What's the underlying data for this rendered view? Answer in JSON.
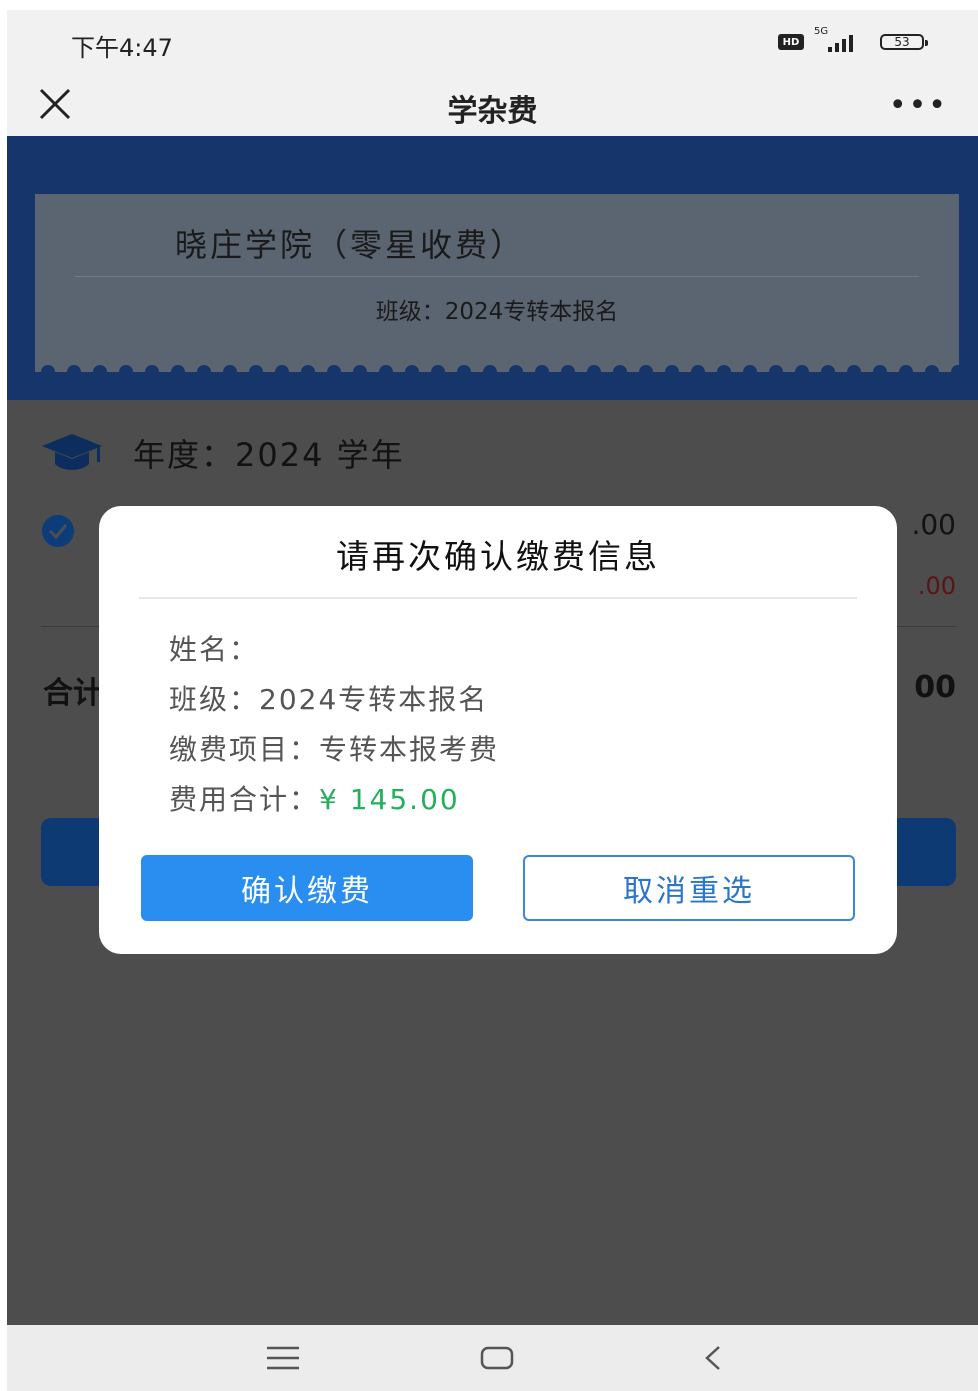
{
  "status_bar": {
    "time": "下午4:47",
    "hd": "HD",
    "network": "5G",
    "battery": "53"
  },
  "nav": {
    "title": "学杂费"
  },
  "header": {
    "school": "晓庄学院（零星收费）",
    "class_line": "班级：2024专转本报名"
  },
  "body": {
    "year_line": "年度：2024 学年",
    "item_amount_peek": ".00",
    "item_sub_amount_peek": ".00",
    "total_label_peek": "合计",
    "total_amount_peek": "00"
  },
  "dialog": {
    "title": "请再次确认缴费信息",
    "name_label": "姓名：",
    "name_value": "",
    "class_label": "班级：",
    "class_value": "2024专转本报名",
    "item_label": "缴费项目：",
    "item_value": "专转本报考费",
    "total_label": "费用合计：",
    "total_value": "¥ 145.00",
    "confirm_label": "确认缴费",
    "cancel_label": "取消重选"
  },
  "colors": {
    "primary": "#2a8df0",
    "money": "#22b05a",
    "overlay": "#4d4d4d",
    "header_bg": "#15356b"
  }
}
